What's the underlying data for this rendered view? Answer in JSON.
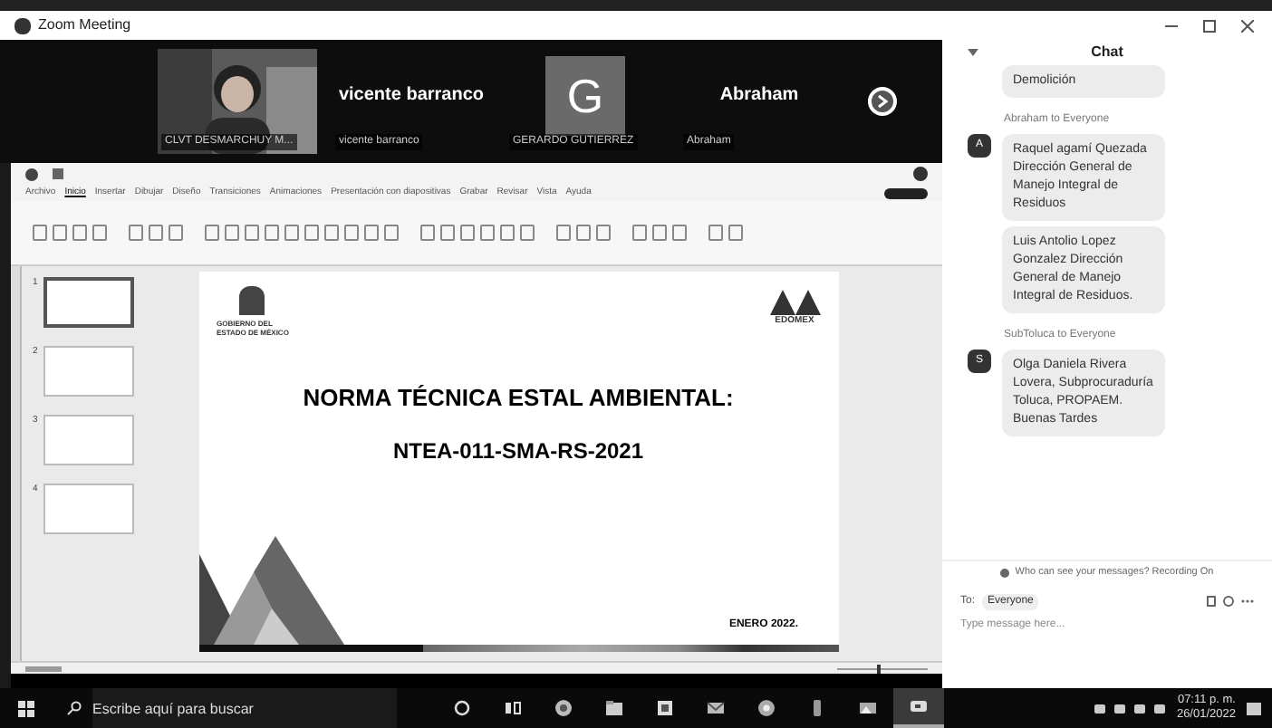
{
  "window": {
    "title": "Zoom Meeting"
  },
  "gallery": [
    {
      "kind": "video",
      "name": "CLVT DESMARCHUY M..."
    },
    {
      "kind": "label",
      "display": "vicente barranco",
      "name": "vicente barranco"
    },
    {
      "kind": "avatar",
      "initial": "G",
      "name": "GERARDO GUTIERREZ"
    },
    {
      "kind": "label",
      "display": "Abraham",
      "name": "Abraham"
    }
  ],
  "shared_screen": {
    "ribbon_tabs": [
      {
        "label": "Archivo",
        "selected": false
      },
      {
        "label": "Inicio",
        "selected": true
      },
      {
        "label": "Insertar",
        "selected": false
      },
      {
        "label": "Dibujar",
        "selected": false
      },
      {
        "label": "Diseño",
        "selected": false
      },
      {
        "label": "Transiciones",
        "selected": false
      },
      {
        "label": "Animaciones",
        "selected": false
      },
      {
        "label": "Presentación con diapositivas",
        "selected": false
      },
      {
        "label": "Grabar",
        "selected": false
      },
      {
        "label": "Revisar",
        "selected": false
      },
      {
        "label": "Vista",
        "selected": false
      },
      {
        "label": "Ayuda",
        "selected": false
      }
    ],
    "thumbnails": [
      {
        "number": "1",
        "selected": true
      },
      {
        "number": "2",
        "selected": false
      },
      {
        "number": "3",
        "selected": false
      },
      {
        "number": "4",
        "selected": false
      }
    ],
    "zoom_slider": {
      "level": 0.45
    },
    "slide": {
      "agency": "GOBIERNO DEL ESTADO DE MÉXICO",
      "logo_text": "EDOMEX",
      "title": "NORMA TÉCNICA ESTAL AMBIENTAL:",
      "code": "NTEA-011-SMA-RS-2021",
      "date": "ENERO 2022."
    }
  },
  "chat": {
    "title": "Chat",
    "groups": [
      {
        "bubbles": [
          "Demolición"
        ]
      },
      {
        "header": "Abraham to Everyone",
        "avatar": "A",
        "bubbles": [
          "Raquel agamí Quezada Dirección General de Manejo Integral de Residuos",
          "Luis Antolio Lopez Gonzalez Dirección General de Manejo Integral de Residuos."
        ]
      },
      {
        "header": "SubToluca to Everyone",
        "avatar": "S",
        "bubbles": [
          "Olga Daniela Rivera Lovera, Subprocuraduría Toluca, PROPAEM. Buenas Tardes"
        ]
      }
    ],
    "privacy_note": "Who can see your messages? Recording On",
    "to_label": "To:",
    "recipient": "Everyone",
    "placeholder": "Type message here..."
  },
  "taskbar": {
    "search_placeholder": "Escribe aquí para buscar",
    "apps": [
      {
        "kind": "cortana",
        "selected": false
      },
      {
        "kind": "taskview",
        "selected": false
      },
      {
        "kind": "edge",
        "selected": false
      },
      {
        "kind": "explorer",
        "selected": false
      },
      {
        "kind": "store",
        "selected": false
      },
      {
        "kind": "mail",
        "selected": false
      },
      {
        "kind": "chrome",
        "selected": false
      },
      {
        "kind": "phone",
        "selected": false
      },
      {
        "kind": "photos",
        "selected": false
      },
      {
        "kind": "zoom",
        "selected": true
      }
    ],
    "time": "07:11 p. m.",
    "date": "26/01/2022"
  }
}
